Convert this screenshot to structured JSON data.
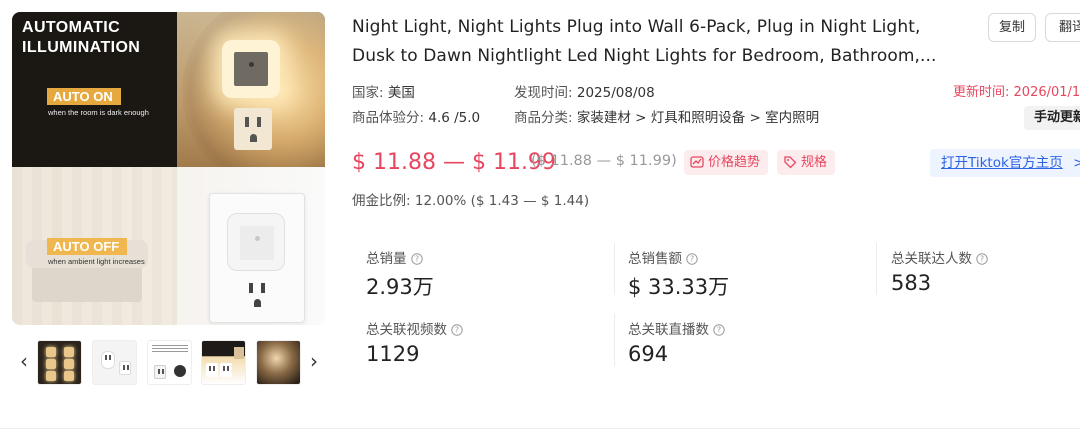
{
  "gallery": {
    "main_image": {
      "headline_line1": "AUTOMATIC",
      "headline_line2": "ILLUMINATION",
      "badge_on": "AUTO ON",
      "caption_on": "when the room is dark enough",
      "badge_off": "AUTO OFF",
      "caption_off": "when ambient light increases"
    },
    "prev_arrow": "‹",
    "next_arrow": "›"
  },
  "product": {
    "title_line1": "Night Light, Night Lights Plug into Wall 6-Pack, Plug in Night Light,",
    "title_line2": "Dusk to Dawn Nightlight Led Night Lights for Bedroom, Bathroom,..."
  },
  "actions": {
    "copy_label": "复制",
    "translate_label": "翻译",
    "manual_update_label": "手动更新",
    "tiktok_label": "打开Tiktok官方主页",
    "tiktok_chevron": ">"
  },
  "meta": {
    "country_label": "国家:",
    "country_value": "美国",
    "found_label": "发现时间:",
    "found_value": "2025/08/08",
    "score_label": "商品体验分:",
    "score_value": "4.6 /5.0",
    "category_label": "商品分类:",
    "category_value": "家装建材 > 灯具和照明设备 > 室内照明",
    "updated_label": "更新时间:",
    "updated_value": "2026/01/1"
  },
  "price": {
    "range": "$ 11.88 — $ 11.99",
    "original": "($ 11.88 — $ 11.99)",
    "trend_label": "价格趋势",
    "spec_label": "规格",
    "commission_label": "佣金比例:",
    "commission_value": "12.00% ($ 1.43 — $ 1.44)"
  },
  "stats": [
    {
      "label": "总销量",
      "value": "2.93万"
    },
    {
      "label": "总销售额",
      "value": "$ 33.33万"
    },
    {
      "label": "总关联达人数",
      "value": "583"
    },
    {
      "label": "总关联视频数",
      "value": "1129"
    },
    {
      "label": "总关联直播数",
      "value": "694"
    }
  ],
  "colors": {
    "accent_red": "#e8465f",
    "link_blue": "#2e63e6",
    "chip_bg": "#fdecee",
    "tiktok_bg": "#edf3ff"
  }
}
